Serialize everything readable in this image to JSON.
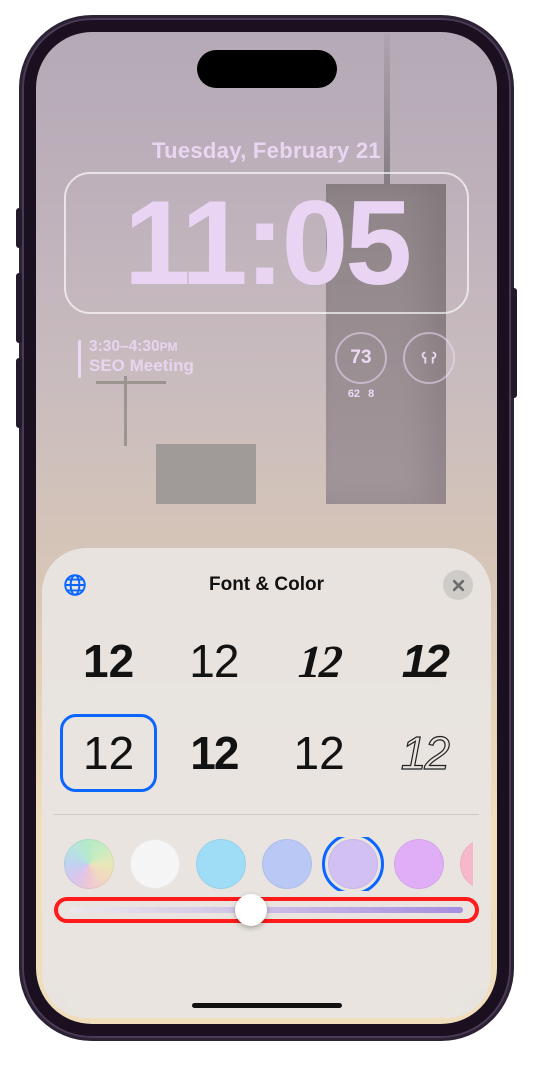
{
  "lockscreen": {
    "date": "Tuesday, February 21",
    "time": "11:05",
    "calendar": {
      "time_range": "3:30–4:30",
      "ampm": "PM",
      "title": "SEO Meeting"
    },
    "weather": {
      "temp": "73",
      "low": "62",
      "high": "8"
    },
    "accent_color": "#e7d3f2"
  },
  "sheet": {
    "title": "Font & Color",
    "font_sample": "12",
    "fonts": [
      {
        "style": "ft-0",
        "selected": false
      },
      {
        "style": "ft-1",
        "selected": false
      },
      {
        "style": "ft-2",
        "selected": false
      },
      {
        "style": "ft-3",
        "selected": false
      },
      {
        "style": "ft-4",
        "selected": true
      },
      {
        "style": "ft-5",
        "selected": false
      },
      {
        "style": "ft-6",
        "selected": false
      },
      {
        "style": "ft-7",
        "selected": false
      }
    ],
    "colors": [
      {
        "name": "rainbow",
        "css": "",
        "rainbow": true,
        "selected": false
      },
      {
        "name": "white",
        "css": "#f5f5f5",
        "selected": false
      },
      {
        "name": "sky",
        "css": "#9fdcf6",
        "selected": false
      },
      {
        "name": "blue",
        "css": "#b9c8f5",
        "selected": false
      },
      {
        "name": "lavender",
        "css": "#d3c0f3",
        "selected": true
      },
      {
        "name": "purple",
        "css": "#dfaef7",
        "selected": false
      },
      {
        "name": "pink",
        "css": "#f6b9cb",
        "selected": false
      }
    ],
    "slider_percent": 46
  }
}
